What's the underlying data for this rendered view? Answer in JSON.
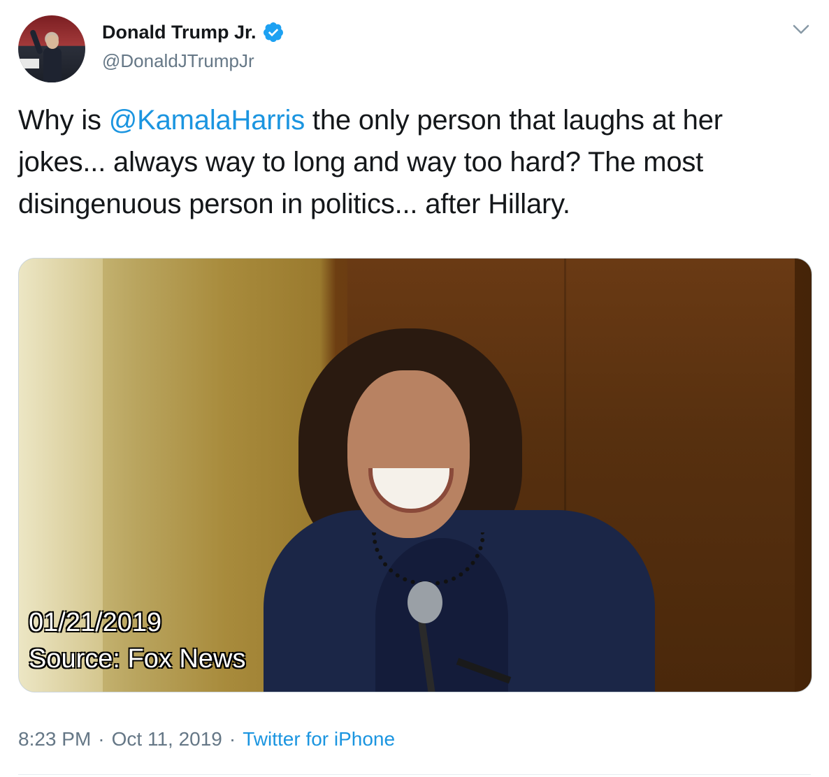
{
  "tweet": {
    "author": {
      "name": "Donald Trump Jr.",
      "handle": "@DonaldJTrumpJr",
      "verified": true
    },
    "text": {
      "part1": "Why is ",
      "mention": "@KamalaHarris",
      "part2": " the only person that laughs at her jokes... always way to long and way too hard? The most disingenuous person in politics... after Hillary."
    },
    "media": {
      "overlay_date": "01/21/2019",
      "overlay_source": "Source: Fox News"
    },
    "meta": {
      "time": "8:23 PM",
      "separator1": "·",
      "date": "Oct 11, 2019",
      "separator2": "·",
      "client": "Twitter for iPhone"
    }
  },
  "colors": {
    "link": "#1b95e0",
    "secondary": "#657786",
    "primary_text": "#14171a"
  },
  "icons": {
    "verified": "verified-badge-icon",
    "menu": "chevron-down-icon"
  }
}
